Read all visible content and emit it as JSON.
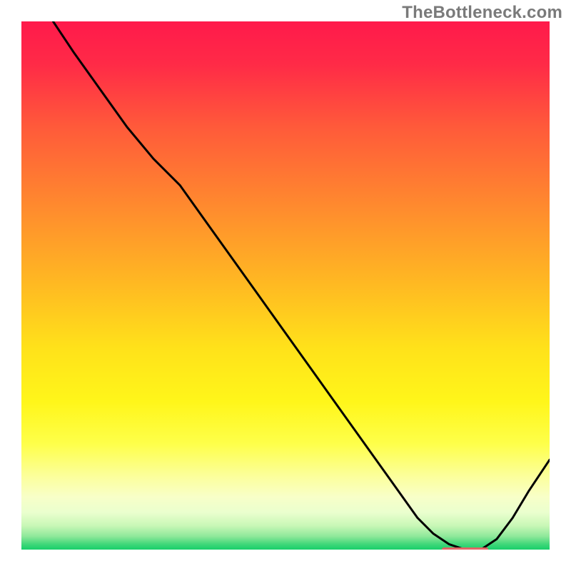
{
  "watermark": "TheBottleneck.com",
  "chart_data": {
    "type": "line",
    "title": "",
    "xlabel": "",
    "ylabel": "",
    "xlim": [
      0,
      100
    ],
    "ylim": [
      0,
      100
    ],
    "grid": false,
    "series": [
      {
        "name": "curve",
        "color": "#000000",
        "x": [
          6,
          10,
          15,
          20,
          25,
          30,
          35,
          40,
          45,
          50,
          55,
          60,
          65,
          70,
          75,
          78,
          81,
          84,
          87,
          90,
          93,
          96,
          100
        ],
        "y": [
          100,
          94,
          87,
          80,
          74,
          69,
          62,
          55,
          48,
          41,
          34,
          27,
          20,
          13,
          6,
          3,
          1,
          0,
          0,
          2,
          6,
          11,
          17
        ]
      }
    ],
    "marker": {
      "name": "highlight-segment",
      "color": "#e06666",
      "x_start": 80,
      "x_end": 88,
      "y": 0,
      "thickness_px": 6
    },
    "background_gradient": {
      "stops": [
        {
          "offset": 0.0,
          "color": "#ff1a4b"
        },
        {
          "offset": 0.08,
          "color": "#ff2a47"
        },
        {
          "offset": 0.2,
          "color": "#ff5a3a"
        },
        {
          "offset": 0.35,
          "color": "#ff8a2e"
        },
        {
          "offset": 0.5,
          "color": "#ffba22"
        },
        {
          "offset": 0.62,
          "color": "#ffe21a"
        },
        {
          "offset": 0.72,
          "color": "#fff61a"
        },
        {
          "offset": 0.8,
          "color": "#feff4a"
        },
        {
          "offset": 0.86,
          "color": "#fcff9a"
        },
        {
          "offset": 0.9,
          "color": "#f8ffc8"
        },
        {
          "offset": 0.93,
          "color": "#eaffce"
        },
        {
          "offset": 0.955,
          "color": "#c8f7b6"
        },
        {
          "offset": 0.975,
          "color": "#8ee89a"
        },
        {
          "offset": 0.99,
          "color": "#3fd779"
        },
        {
          "offset": 1.0,
          "color": "#19cf6a"
        }
      ]
    }
  }
}
